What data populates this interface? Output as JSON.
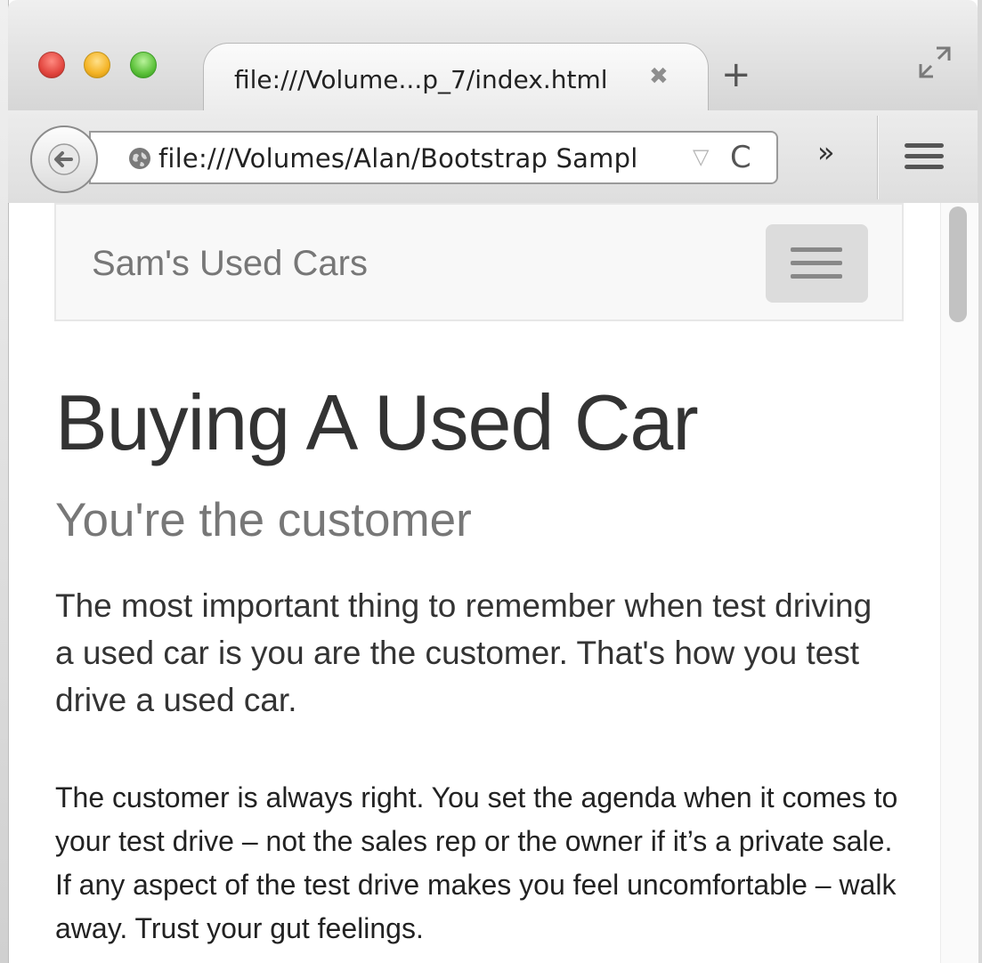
{
  "browser": {
    "tab_title": "file:///Volume...p_7/index.html",
    "tab_close_glyph": "✖",
    "new_tab_glyph": "+",
    "url": "file:///Volumes/Alan/Bootstrap Sampl",
    "url_dropdown_glyph": "▽",
    "reload_glyph": "C",
    "overflow_glyph": "»",
    "icons": [
      "back-arrow-icon",
      "globe-icon",
      "fullscreen-icon",
      "menu-icon",
      "close-icon",
      "minimize-icon",
      "maximize-icon"
    ]
  },
  "navbar": {
    "brand": "Sam's Used Cars",
    "toggle_icon": "hamburger-icon"
  },
  "page": {
    "title": "Buying A Used Car",
    "subtitle": "You're the customer",
    "lead": "The most important thing to remember when test driving a used car is you are the customer. That's how you test drive a used car.",
    "body": "The customer is always right. You set the agenda when it comes to your test drive – not the sales rep or the owner if it’s a private sale. If any aspect of the test drive makes you feel uncomfortable – walk away. Trust your gut feelings."
  },
  "colors": {
    "navbar_bg": "#f8f8f8",
    "navbar_border": "#e7e7e7",
    "brand_text": "#777777",
    "heading_text": "#333333",
    "subtitle_text": "#777777",
    "toggle_bg": "#dddddd"
  }
}
